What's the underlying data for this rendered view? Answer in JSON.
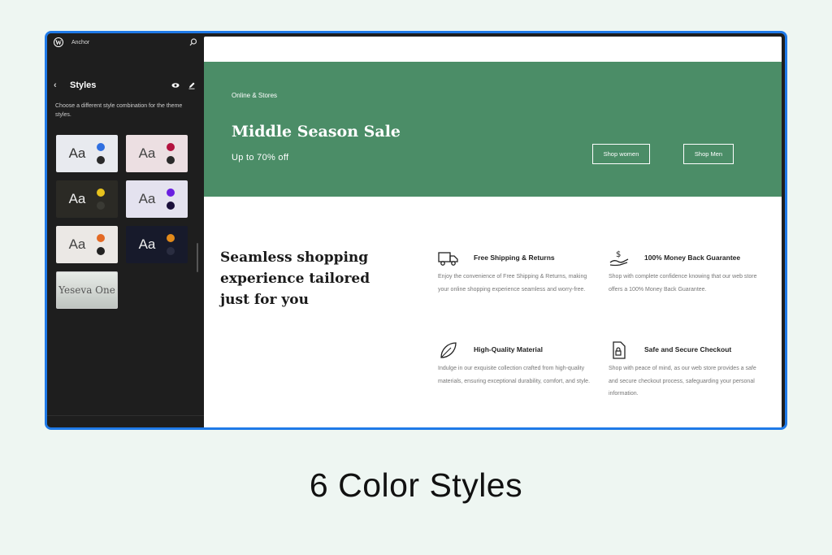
{
  "sidebar": {
    "site_name": "Anchor",
    "panel_title": "Styles",
    "description": "Choose a different style combination for the theme styles.",
    "variations": [
      {
        "label": "Aa",
        "bg": "#e8eaef",
        "text": "#333",
        "dot1": "#2f6fe0",
        "dot2": "#2a2a2a"
      },
      {
        "label": "Aa",
        "bg": "#ecdfe2",
        "text": "#444",
        "dot1": "#b3123f",
        "dot2": "#2a2a2a"
      },
      {
        "label": "Aa",
        "bg": "#2b2a25",
        "text": "#eee",
        "dot1": "#e7c21d",
        "dot2": "#3a3a34"
      },
      {
        "label": "Aa",
        "bg": "#e4e2ef",
        "text": "#444",
        "dot1": "#6a1fe0",
        "dot2": "#1a0f3a"
      },
      {
        "label": "Aa",
        "bg": "#ebe8e5",
        "text": "#444",
        "dot1": "#e36a25",
        "dot2": "#222"
      },
      {
        "label": "Aa",
        "bg": "#171a2b",
        "text": "#eee",
        "dot1": "#e28a1a",
        "dot2": "#2a2d40"
      }
    ],
    "font_variation": "Yeseva One"
  },
  "hero": {
    "eyebrow": "Online & Stores",
    "title": "Middle Season Sale",
    "subtitle": "Up to 70% off",
    "button_women": "Shop women",
    "button_men": "Shop Men",
    "bg": "#4b8d67"
  },
  "lead": "Seamless shopping experience tailored just for you",
  "features": [
    {
      "icon": "truck-icon",
      "title": "Free Shipping & Returns",
      "desc": "Enjoy the convenience of Free Shipping & Returns, making your online shopping experience seamless and worry-free."
    },
    {
      "icon": "money-hand-icon",
      "title": "100% Money Back Guarantee",
      "desc": "Shop with complete confidence knowing that our web store offers a 100% Money Back Guarantee."
    },
    {
      "icon": "leaf-icon",
      "title": "High-Quality Material",
      "desc": "Indulge in our exquisite collection crafted from high-quality materials, ensuring exceptional durability, comfort, and style."
    },
    {
      "icon": "secure-document-icon",
      "title": "Safe and Secure Checkout",
      "desc": "Shop with peace of mind, as our web store provides a safe and secure checkout process, safeguarding your personal information."
    }
  ],
  "caption": "6 Color Styles",
  "colors": {
    "frame_border": "#1f7ae8",
    "page_bg": "#eef6f2",
    "sidebar_bg": "#1e1e1e"
  }
}
